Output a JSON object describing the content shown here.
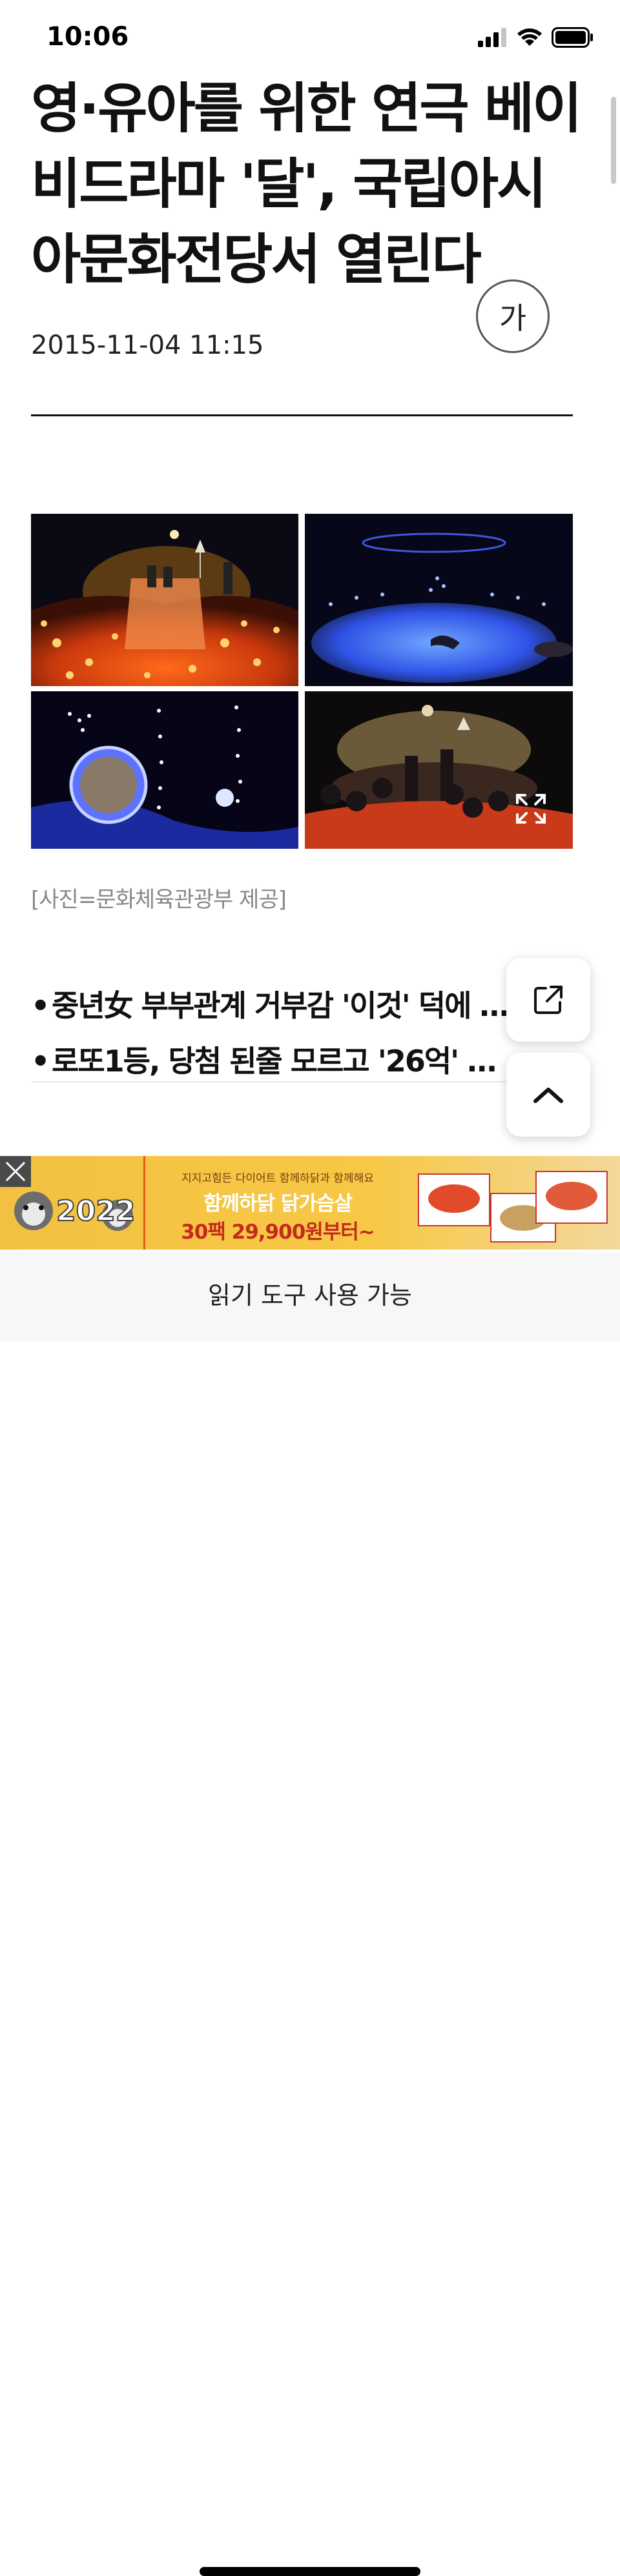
{
  "status_bar": {
    "time": "10:06"
  },
  "article": {
    "headline": "영·유아를 위한 연극 베이비드라마 '달', 국립아시아문화전당서 열린다",
    "font_size_button": "가",
    "date": "2015-11-04 11:15",
    "photo_caption": "[사진=문화체육관광부 제공]"
  },
  "related_articles": [
    {
      "text": "중년女 부부관계 거부감 '이것' 덕에 …"
    },
    {
      "text": "로또1등, 당첨 된줄 모르고 '26억' 날…"
    }
  ],
  "ad_banner": {
    "line1": "지지고힘든 다이어트 함께하닭과 함께해요",
    "line2": "함께하닭 닭가슴살",
    "line3": "30팩 29,900원부터~",
    "badge": "2022"
  },
  "reader_bar": {
    "label": "읽기 도구 사용 가능"
  },
  "icons": {
    "signal": "signal-icon",
    "wifi": "wifi-icon",
    "battery": "battery-icon",
    "share": "share-icon",
    "scroll_top": "chevron-up-icon",
    "expand": "expand-icon",
    "close": "close-icon"
  }
}
